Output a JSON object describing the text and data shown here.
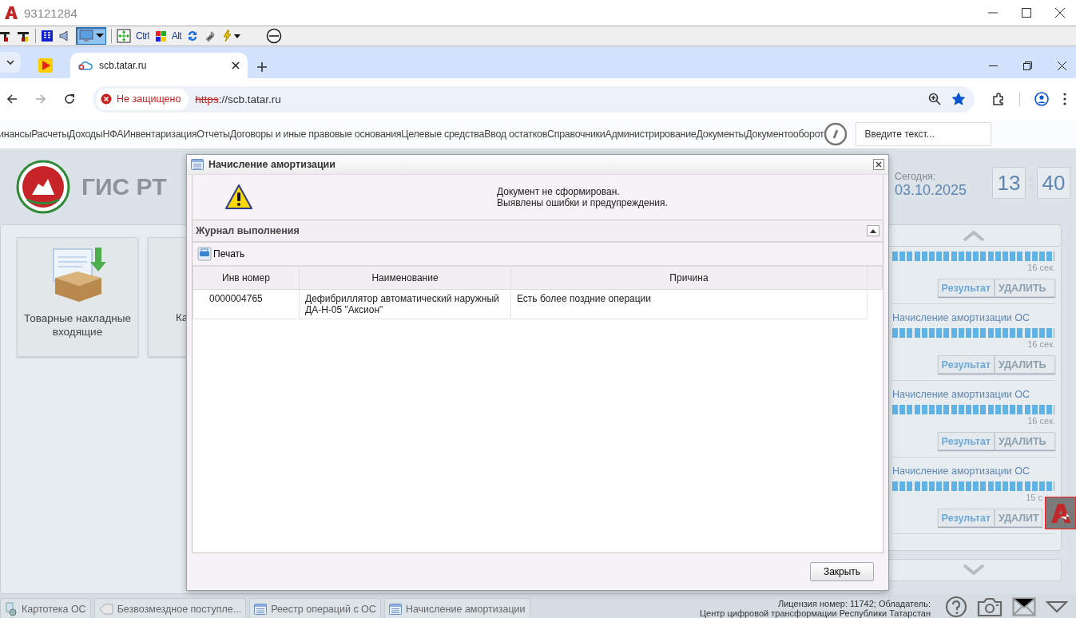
{
  "remote_window": {
    "title": "93121284",
    "toolbar": {
      "ctrl": "Ctrl",
      "alt": "Alt",
      "display_button": {
        "pressed": true
      }
    }
  },
  "browser": {
    "tabs": [
      {
        "kind": "pinned",
        "selected": false
      },
      {
        "kind": "page",
        "title": "scb.tatar.ru",
        "selected": true
      }
    ],
    "address": {
      "security": "Не защищено",
      "url_scheme": "https",
      "url_rest": "://scb.tatar.ru",
      "bookmarked": true
    }
  },
  "app": {
    "menu": {
      "items": [
        "инансы",
        "Расчеты",
        "Доходы",
        "НФА",
        "Инвентаризация",
        "Отчеты",
        "Договоры и иные правовые основания",
        "Целевые средства",
        "Ввод остатков",
        "Справочники",
        "Администрирование",
        "Документы",
        "Документооборот"
      ],
      "search": {
        "placeholder": "Введите текст..."
      }
    },
    "header": {
      "logo_text": "ГИС РТ",
      "today_label": "Сегодня:",
      "date": "03.10.2025",
      "hours": "13",
      "minutes": "40"
    },
    "tiles": [
      {
        "label": "Товарные накладные входящие",
        "kind": "invoice"
      },
      {
        "label": "Ка",
        "kind": "hidden"
      }
    ],
    "tasks": [
      {
        "level": 1,
        "elapsed": "16 сек.",
        "result_button": "Результат",
        "delete_button": "УДАЛИТЬ"
      },
      {
        "title": "Начисление амортизации ОС",
        "level": 1,
        "elapsed": "16 сек.",
        "result_button": "Результат",
        "delete_button": "УДАЛИТЬ"
      },
      {
        "title": "Начисление амортизации ОС",
        "level": 1,
        "elapsed": "16 сек.",
        "result_button": "Результат",
        "delete_button": "УДАЛИТЬ"
      },
      {
        "title": "Начисление амортизации ОС",
        "level": 1,
        "elapsed": "15 с",
        "result_button": "Результат",
        "delete_button": "УДАЛИТ"
      }
    ],
    "taskbar": {
      "tabs": [
        {
          "label": "Картотека ОС",
          "kind": "cards"
        },
        {
          "label": "Безвозмездное поступле...",
          "kind": "tag"
        },
        {
          "label": "Реестр операций с ОС",
          "kind": "list"
        },
        {
          "label": "Начисление амортизации",
          "kind": "list"
        }
      ],
      "license": [
        "Лицензия номер: 11742; Обладатель:",
        "Центр цифровой трансформации Республики Татарстан"
      ]
    }
  },
  "dialog": {
    "title": "Начисление амортизации",
    "message": [
      "Документ не сформирован.",
      "Выявлены ошибки и предупреждения."
    ],
    "log": {
      "title": "Журнал выполнения",
      "print_button": "Печать",
      "table": {
        "columns": [
          "Инв номер",
          "Наименование",
          "Причина"
        ],
        "rows": [
          [
            "0000004765",
            "Дефибриллятор автоматический наружный ДА-Н-05 \"Аксион\"",
            "Есть более поздние операции"
          ]
        ]
      }
    },
    "close_button": "Закрыть"
  }
}
